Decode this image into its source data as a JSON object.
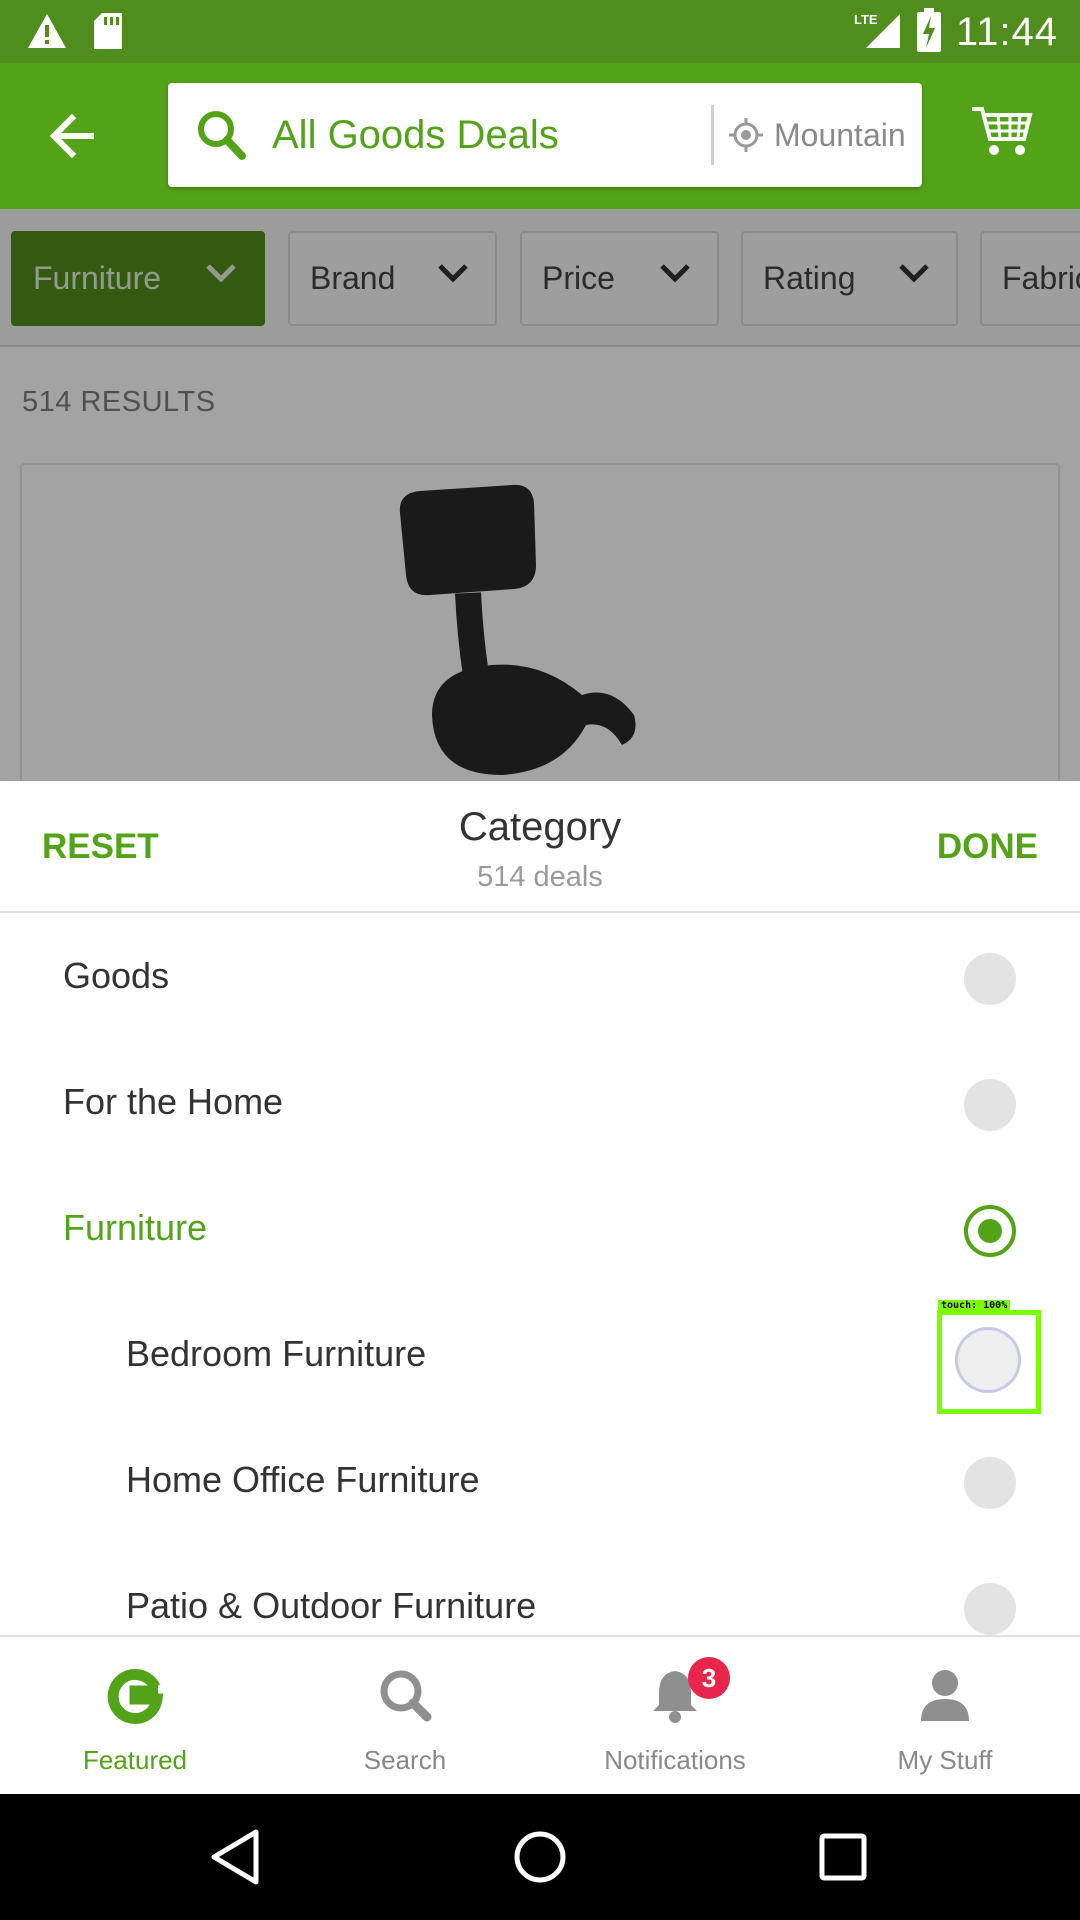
{
  "status_bar": {
    "time": "11:44",
    "network": "LTE",
    "icons": [
      "warning-icon",
      "sd-card-icon",
      "signal-icon",
      "battery-charging-icon"
    ]
  },
  "header": {
    "search_text": "All Goods Deals",
    "location_text": "Mountain View",
    "icons": [
      "back-arrow-icon",
      "search-icon",
      "location-icon",
      "cart-icon"
    ]
  },
  "filters": [
    {
      "label": "Furniture",
      "active": true
    },
    {
      "label": "Brand",
      "active": false
    },
    {
      "label": "Price",
      "active": false
    },
    {
      "label": "Rating",
      "active": false
    },
    {
      "label": "Fabric",
      "active": false
    }
  ],
  "results": {
    "count_label": "514 RESULTS"
  },
  "sheet": {
    "reset_label": "RESET",
    "done_label": "DONE",
    "title": "Category",
    "subtitle": "514 deals"
  },
  "categories": [
    {
      "label": "Goods",
      "selected": false,
      "indent": 0
    },
    {
      "label": "For the Home",
      "selected": false,
      "indent": 0
    },
    {
      "label": "Furniture",
      "selected": true,
      "indent": 0
    },
    {
      "label": "Bedroom Furniture",
      "selected": false,
      "indent": 1
    },
    {
      "label": "Home Office Furniture",
      "selected": false,
      "indent": 1
    },
    {
      "label": "Patio & Outdoor Furniture",
      "selected": false,
      "indent": 1
    }
  ],
  "touch_overlay": {
    "label": "touch: 100%"
  },
  "bottom_nav": [
    {
      "label": "Featured",
      "icon": "groupon-g-icon",
      "active": true
    },
    {
      "label": "Search",
      "icon": "search-icon",
      "active": false
    },
    {
      "label": "Notifications",
      "icon": "bell-icon",
      "active": false,
      "badge": "3"
    },
    {
      "label": "My Stuff",
      "icon": "person-icon",
      "active": false
    }
  ],
  "colors": {
    "brand_green": "#53a318",
    "dark_green": "#4f8e1c",
    "badge_red": "#e8254a"
  }
}
